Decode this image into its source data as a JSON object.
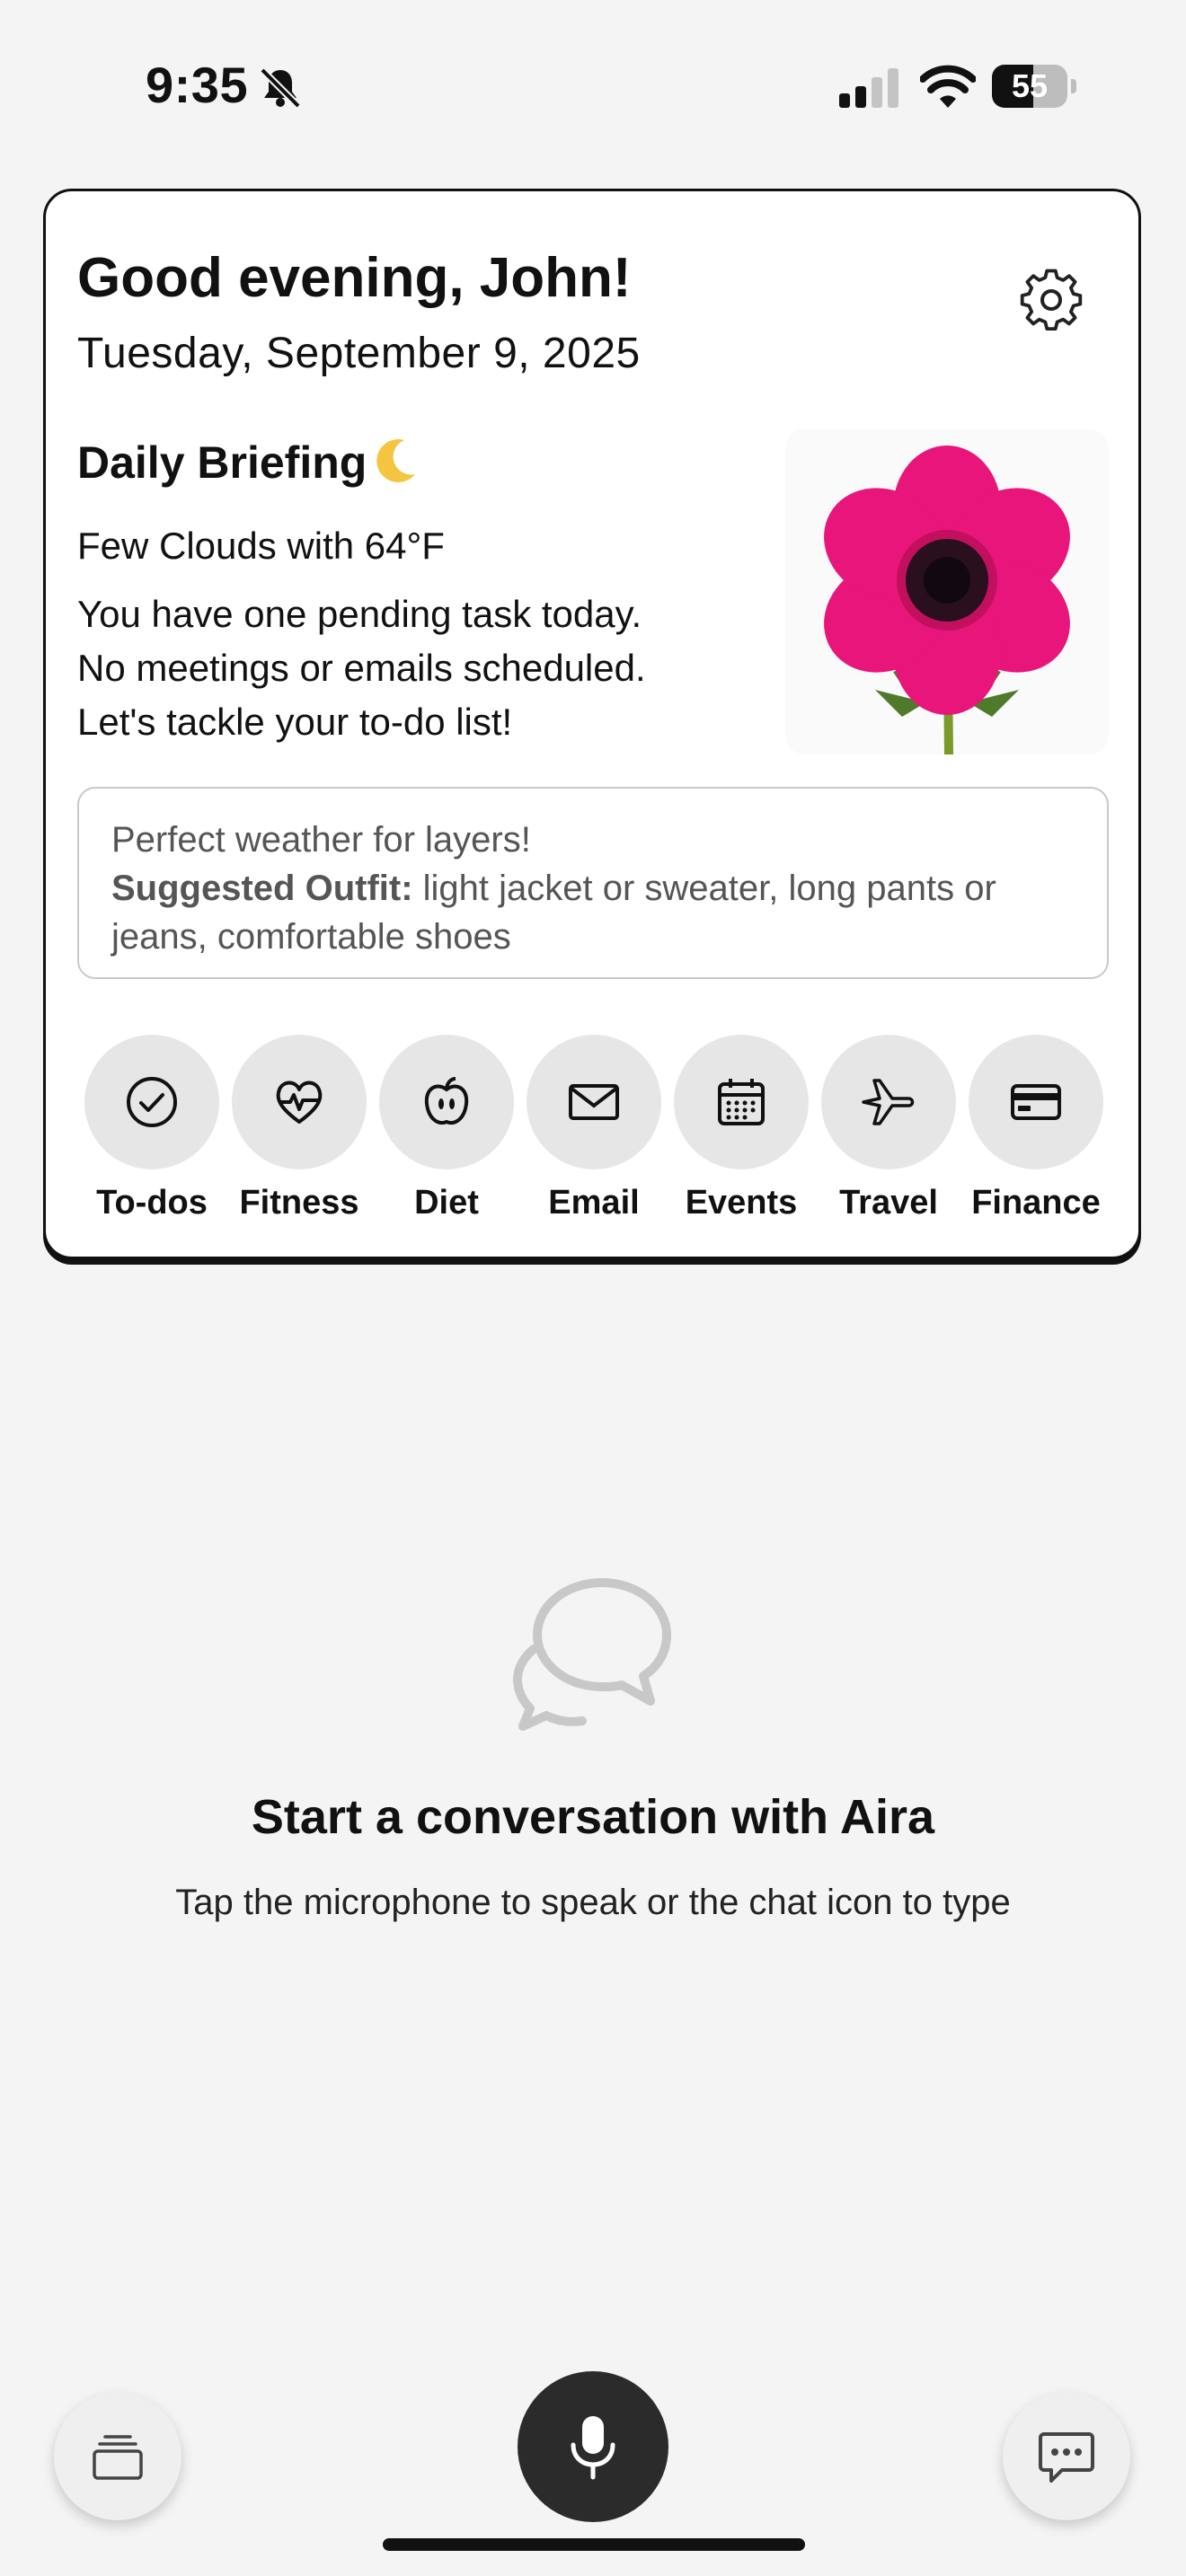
{
  "status_bar": {
    "time": "9:35",
    "battery_percent": "55",
    "battery_level": 0.55,
    "icons": [
      "bell-slash-icon",
      "cellular-signal-icon",
      "wifi-icon",
      "battery-icon"
    ]
  },
  "card": {
    "greeting": "Good evening, John!",
    "date": "Tuesday, September 9, 2025",
    "briefing_title": "Daily Briefing",
    "weather": "Few Clouds with 64°F",
    "summary_lines": [
      "You have one pending task today.",
      "No meetings or emails scheduled.",
      "Let's tackle your to-do list!"
    ],
    "outfit": {
      "headline": "Perfect weather for layers!",
      "label": "Suggested Outfit:",
      "text": " light jacket or sweater, long pants or jeans, comfortable shoes"
    },
    "categories": [
      {
        "label": "To-dos",
        "icon": "check-circle-icon"
      },
      {
        "label": "Fitness",
        "icon": "heart-pulse-icon"
      },
      {
        "label": "Diet",
        "icon": "apple-icon"
      },
      {
        "label": "Email",
        "icon": "envelope-icon"
      },
      {
        "label": "Events",
        "icon": "calendar-icon"
      },
      {
        "label": "Travel",
        "icon": "airplane-icon"
      },
      {
        "label": "Finance",
        "icon": "credit-card-icon"
      }
    ]
  },
  "empty_state": {
    "title": "Start a conversation with Aira",
    "subtitle": "Tap the microphone to speak or the chat icon to type"
  },
  "colors": {
    "background": "#f4f4f4",
    "flower": "#e8157a",
    "mic_button": "#2b2b2b"
  }
}
